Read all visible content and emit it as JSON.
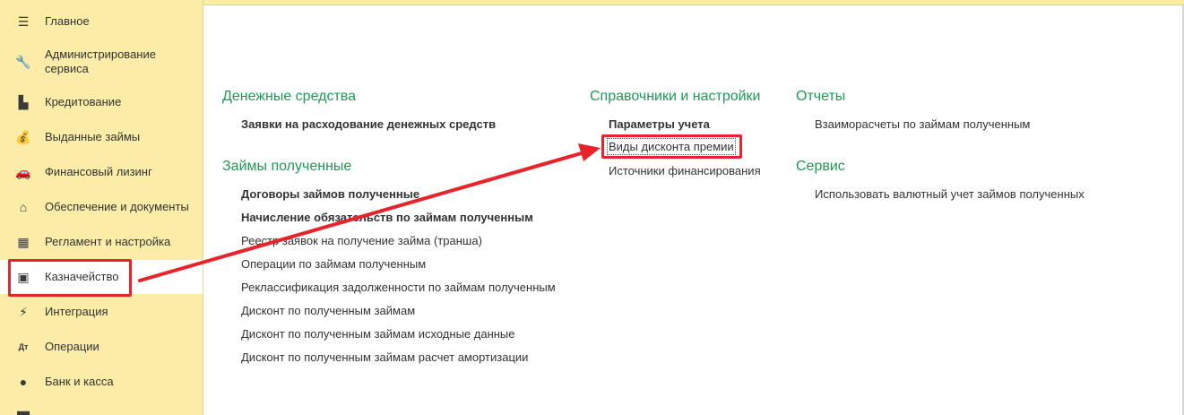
{
  "sidebar": {
    "items": [
      {
        "label": "Главное",
        "icon": "menu-icon"
      },
      {
        "label": "Администрирование сервиса",
        "icon": "wrench-icon"
      },
      {
        "label": "Кредитование",
        "icon": "document-icon"
      },
      {
        "label": "Выданные займы",
        "icon": "money-bag-icon"
      },
      {
        "label": "Финансовый лизинг",
        "icon": "car-icon"
      },
      {
        "label": "Обеспечение и документы",
        "icon": "house-icon"
      },
      {
        "label": "Регламент и настройка",
        "icon": "calendar-icon"
      },
      {
        "label": "Казначейство",
        "icon": "safe-icon"
      },
      {
        "label": "Интеграция",
        "icon": "plug-icon"
      },
      {
        "label": "Операции",
        "icon": "dt-kt-icon"
      },
      {
        "label": "Банк и касса",
        "icon": "coin-icon"
      }
    ]
  },
  "main": {
    "sections": {
      "money": {
        "title": "Денежные средства",
        "links": [
          "Заявки на расходование денежных средств"
        ]
      },
      "loans": {
        "title": "Займы полученные",
        "links": [
          "Договоры займов полученные",
          "Начисление обязательств по займам полученным",
          "Реестр заявок на получение займа (транша)",
          "Операции по займам полученным",
          "Реклассификация задолженности по займам полученным",
          "Дисконт по полученным займам",
          "Дисконт по полученным займам исходные данные",
          "Дисконт по полученным займам расчет амортизации"
        ]
      },
      "refs": {
        "title": "Справочники и настройки",
        "links": [
          "Параметры учета",
          "Виды дисконта премии",
          "Источники финансирования"
        ]
      },
      "reports": {
        "title": "Отчеты",
        "links": [
          "Взаиморасчеты по займам полученным"
        ]
      },
      "service": {
        "title": "Сервис",
        "links": [
          "Использовать валютный учет займов полученных"
        ]
      }
    }
  },
  "colors": {
    "sidebar_bg": "#fbeca7",
    "section_title": "#1d9a56",
    "annotation_red": "#e8232a"
  }
}
